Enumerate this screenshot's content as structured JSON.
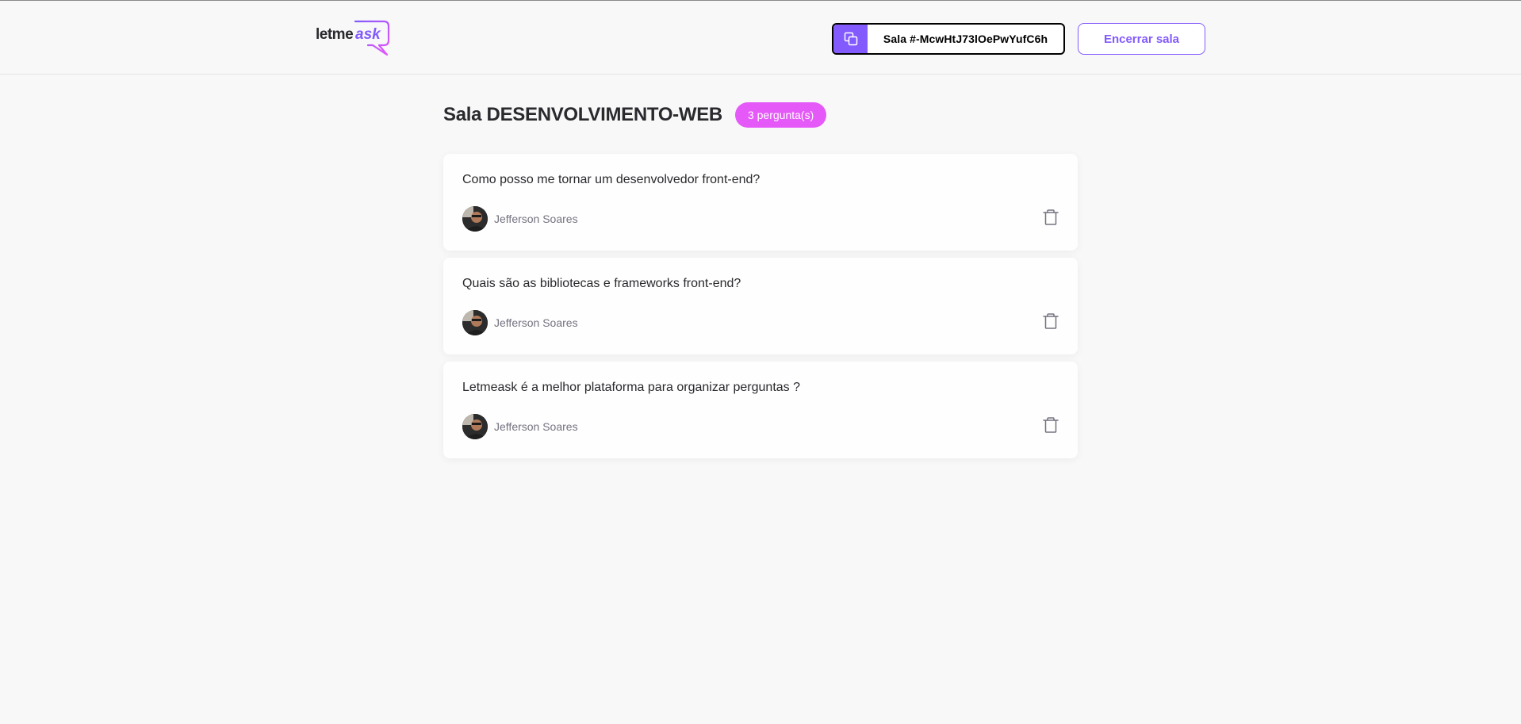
{
  "header": {
    "logo": {
      "part1": "letme",
      "part2": "ask"
    },
    "room_code_label": "Sala #-McwHtJ73lOePwYufC6h",
    "close_room_label": "Encerrar sala"
  },
  "main": {
    "title": "Sala DESENVOLVIMENTO-WEB",
    "badge": "3 pergunta(s)",
    "questions": [
      {
        "content": "Como posso me tornar um desenvolvedor front-end?",
        "author": "Jefferson Soares"
      },
      {
        "content": "Quais são as bibliotecas e frameworks front-end?",
        "author": "Jefferson Soares"
      },
      {
        "content": "Letmeask é a melhor plataforma para organizar perguntas ?",
        "author": "Jefferson Soares"
      }
    ]
  },
  "colors": {
    "accent": "#835afd",
    "badge": "#e559f9",
    "background": "#f8f8f8",
    "text": "#29292e",
    "muted": "#737380"
  },
  "icons": {
    "copy": "copy-icon",
    "delete": "trash-icon"
  }
}
